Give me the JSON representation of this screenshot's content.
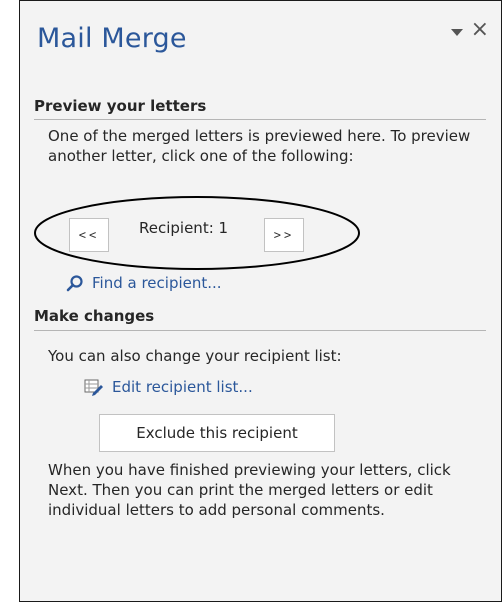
{
  "pane": {
    "title": "Mail Merge",
    "menu_icon": "dropdown-arrow-icon",
    "close_label": "×"
  },
  "preview": {
    "heading": "Preview your letters",
    "description": "One of the merged letters is previewed here. To preview another letter, click one of the following:",
    "prev_label": "<<",
    "recipient_label": "Recipient: 1",
    "next_label": ">>",
    "find_label": "Find a recipient...",
    "find_icon": "search-icon"
  },
  "changes": {
    "heading": "Make changes",
    "description": "You can also change your recipient list:",
    "edit_label": "Edit recipient list...",
    "edit_icon": "edit-list-icon",
    "exclude_label": "Exclude this recipient",
    "finish_text": "When you have finished previewing your letters, click Next. Then you can print the merged letters or edit individual letters to add personal comments."
  },
  "colors": {
    "accent": "#2b579a",
    "pane_bg": "#f3f3f3",
    "annotation": "#000000"
  }
}
